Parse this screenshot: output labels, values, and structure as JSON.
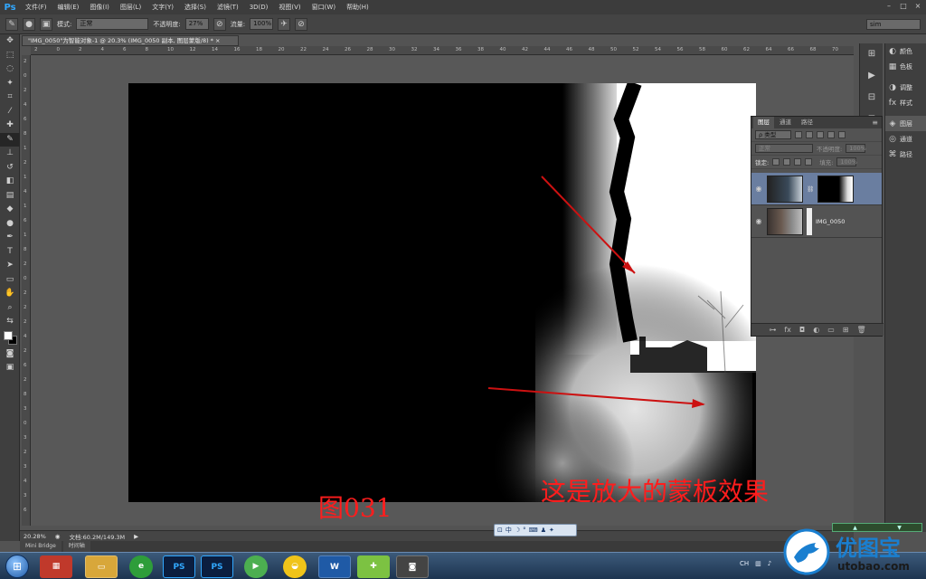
{
  "app": {
    "logo": "Ps",
    "menus": [
      "文件(F)",
      "编辑(E)",
      "图像(I)",
      "图层(L)",
      "文字(Y)",
      "选择(S)",
      "滤镜(T)",
      "3D(D)",
      "视图(V)",
      "窗口(W)",
      "帮助(H)"
    ]
  },
  "options": {
    "mode_label": "模式:",
    "mode_value": "正常",
    "opacity_label": "不透明度:",
    "opacity_value": "27%",
    "flow_label": "流量:",
    "flow_value": "100%",
    "workspace_value": "sim"
  },
  "document": {
    "tab_title": "\"IMG_0050\"为智能对象-1 @ 20.3% (IMG_0050 副本, 图层蒙版/8) *",
    "zoom": "20.28%",
    "doc_info": "文档:60.2M/149.3M"
  },
  "rulers": {
    "top": [
      "2",
      "0",
      "2",
      "4",
      "6",
      "8",
      "10",
      "12",
      "14",
      "16",
      "18",
      "20",
      "22",
      "24",
      "26",
      "28",
      "30",
      "32",
      "34",
      "36",
      "38",
      "40",
      "42",
      "44",
      "46",
      "48",
      "50",
      "52",
      "54",
      "56",
      "58",
      "60",
      "62",
      "64",
      "66",
      "68",
      "70"
    ],
    "left": [
      "2",
      "0",
      "2",
      "4",
      "6",
      "8",
      "1",
      "2",
      "1",
      "4",
      "1",
      "6",
      "1",
      "8",
      "2",
      "0",
      "2",
      "2",
      "2",
      "4",
      "2",
      "6",
      "2",
      "8",
      "3",
      "0",
      "3",
      "2",
      "3",
      "4",
      "3",
      "6"
    ]
  },
  "annotations": {
    "figure_label": "图031",
    "mask_note": "这是放大的蒙板效果"
  },
  "layers_panel": {
    "tabs": [
      "图层",
      "通道",
      "路径"
    ],
    "filter_kind": "ρ 类型",
    "blend_mode": "正常",
    "opacity_label": "不透明度:",
    "opacity_value": "100%",
    "lock_label": "锁定:",
    "fill_label": "填充:",
    "fill_value": "100%",
    "layers": [
      {
        "name": "",
        "selected": true,
        "has_mask": true
      },
      {
        "name": "IMG_0050",
        "selected": false,
        "has_mask": true
      }
    ]
  },
  "right_dock": {
    "group1": [
      "颜色",
      "色板"
    ],
    "group2": [
      "调整",
      "样式"
    ],
    "group3": [
      "图层",
      "通道",
      "路径"
    ]
  },
  "bottom_tabs": [
    "Mini Bridge",
    "时间轴"
  ],
  "ime": {
    "mode": "中"
  },
  "taskbar": {
    "apps": [
      "PS",
      "PS",
      "W"
    ],
    "tray_lang": "CH"
  },
  "watermark": {
    "name": "优图宝",
    "url": "utobao.com"
  },
  "colors": {
    "annotation_red": "#ff1d1d",
    "ps_blue": "#31a8ff",
    "selected_layer": "#6a7ea0"
  }
}
